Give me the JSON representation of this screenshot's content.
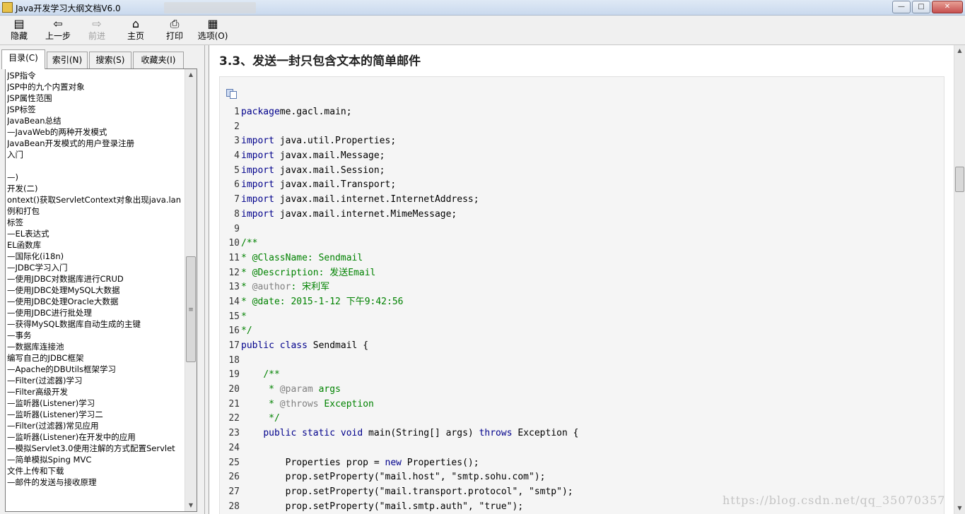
{
  "window": {
    "title": "Java开发学习大纲文档V6.0",
    "minimize": "—",
    "maximize": "□",
    "close": "✕"
  },
  "toolbar": {
    "buttons": [
      {
        "label": "隐藏",
        "icon": "hide-icon",
        "glyph": "▤",
        "enabled": true
      },
      {
        "label": "上一步",
        "icon": "back-arrow-icon",
        "glyph": "⇦",
        "enabled": true
      },
      {
        "label": "前进",
        "icon": "forward-arrow-icon",
        "glyph": "⇨",
        "enabled": false
      },
      {
        "label": "主页",
        "icon": "home-icon",
        "glyph": "⌂",
        "enabled": true
      },
      {
        "label": "打印",
        "icon": "printer-icon",
        "glyph": "⎙",
        "enabled": true
      },
      {
        "label": "选项(O)",
        "icon": "options-icon",
        "glyph": "▦",
        "enabled": true
      }
    ]
  },
  "navigation": {
    "tabs": [
      "目录(C)",
      "索引(N)",
      "搜索(S)",
      "收藏夹(I)"
    ],
    "active_tab": "目录(C)",
    "tree_items": [
      "JSP指令",
      "JSP中的九个内置对象",
      "JSP属性范围",
      "JSP标签",
      "JavaBean总结",
      "—JavaWeb的两种开发模式",
      "JavaBean开发模式的用户登录注册",
      "入门",
      "",
      "—)",
      "开发(二)",
      "ontext()获取ServletContext对象出现java.lan",
      "例和打包",
      "标签",
      "—EL表达式",
      "EL函数库",
      "—国际化(i18n)",
      "—JDBC学习入门",
      "—使用JDBC对数据库进行CRUD",
      "—使用JDBC处理MySQL大数据",
      "—使用JDBC处理Oracle大数据",
      "—使用JDBC进行批处理",
      "—获得MySQL数据库自动生成的主键",
      "—事务",
      "—数据库连接池",
      "编写自己的JDBC框架",
      "—Apache的DBUtils框架学习",
      "—Filter(过滤器)学习",
      "—Filter高级开发",
      "—监听器(Listener)学习",
      "—监听器(Listener)学习二",
      "—Filter(过滤器)常见应用",
      "—监听器(Listener)在开发中的应用",
      "—模拟Servlet3.0使用注解的方式配置Servlet",
      "—简单模拟Sping MVC",
      "文件上传和下载",
      "—邮件的发送与接收原理"
    ]
  },
  "content": {
    "section_title": "3.3、发送一封只包含文本的简单邮件",
    "code_lines": [
      {
        "n": "1",
        "parts": [
          [
            "kw",
            "package"
          ],
          [
            "",
            "me.gacl.main;"
          ]
        ]
      },
      {
        "n": "2",
        "parts": []
      },
      {
        "n": "3",
        "parts": [
          [
            "kw",
            "import"
          ],
          [
            "",
            " java.util.Properties;"
          ]
        ]
      },
      {
        "n": "4",
        "parts": [
          [
            "kw",
            "import"
          ],
          [
            "",
            " javax.mail.Message;"
          ]
        ]
      },
      {
        "n": "5",
        "parts": [
          [
            "kw",
            "import"
          ],
          [
            "",
            " javax.mail.Session;"
          ]
        ]
      },
      {
        "n": "6",
        "parts": [
          [
            "kw",
            "import"
          ],
          [
            "",
            " javax.mail.Transport;"
          ]
        ]
      },
      {
        "n": "7",
        "parts": [
          [
            "kw",
            "import"
          ],
          [
            "",
            " javax.mail.internet.InternetAddress;"
          ]
        ]
      },
      {
        "n": "8",
        "parts": [
          [
            "kw",
            "import"
          ],
          [
            "",
            " javax.mail.internet.MimeMessage;"
          ]
        ]
      },
      {
        "n": "9",
        "parts": []
      },
      {
        "n": "10",
        "parts": [
          [
            "cm",
            "/**"
          ]
        ]
      },
      {
        "n": "11",
        "parts": [
          [
            "cm",
            "* @ClassName: Sendmail"
          ]
        ]
      },
      {
        "n": "12",
        "parts": [
          [
            "cm",
            "* @Description: 发送Email"
          ]
        ]
      },
      {
        "n": "13",
        "parts": [
          [
            "cm",
            "* "
          ],
          [
            "tg",
            "@author"
          ],
          [
            "cm",
            ": 宋利军"
          ]
        ]
      },
      {
        "n": "14",
        "parts": [
          [
            "cm",
            "* @date: 2015-1-12 下午9:42:56"
          ]
        ]
      },
      {
        "n": "15",
        "parts": [
          [
            "cm",
            "*"
          ]
        ]
      },
      {
        "n": "16",
        "parts": [
          [
            "cm",
            "*/"
          ]
        ]
      },
      {
        "n": "17",
        "parts": [
          [
            "kw",
            "public class"
          ],
          [
            "",
            " Sendmail {"
          ]
        ]
      },
      {
        "n": "18",
        "parts": []
      },
      {
        "n": "19",
        "parts": [
          [
            "",
            "    "
          ],
          [
            "cm",
            "/**"
          ]
        ]
      },
      {
        "n": "20",
        "parts": [
          [
            "",
            "     "
          ],
          [
            "cm",
            "* "
          ],
          [
            "tg",
            "@param"
          ],
          [
            "cm",
            " args"
          ]
        ]
      },
      {
        "n": "21",
        "parts": [
          [
            "",
            "     "
          ],
          [
            "cm",
            "* "
          ],
          [
            "tg",
            "@throws"
          ],
          [
            "cm",
            " Exception"
          ]
        ]
      },
      {
        "n": "22",
        "parts": [
          [
            "",
            "     "
          ],
          [
            "cm",
            "*/"
          ]
        ]
      },
      {
        "n": "23",
        "parts": [
          [
            "",
            "    "
          ],
          [
            "kw",
            "public static void"
          ],
          [
            "",
            " main(String[] args) "
          ],
          [
            "kw",
            "throws"
          ],
          [
            "",
            " Exception {"
          ]
        ]
      },
      {
        "n": "24",
        "parts": []
      },
      {
        "n": "25",
        "parts": [
          [
            "",
            "        Properties prop = "
          ],
          [
            "kw",
            "new"
          ],
          [
            "",
            " Properties();"
          ]
        ]
      },
      {
        "n": "26",
        "parts": [
          [
            "",
            "        prop.setProperty(\"mail.host\", \"smtp.sohu.com\");"
          ]
        ]
      },
      {
        "n": "27",
        "parts": [
          [
            "",
            "        prop.setProperty(\"mail.transport.protocol\", \"smtp\");"
          ]
        ]
      },
      {
        "n": "28",
        "parts": [
          [
            "",
            "        prop.setProperty(\"mail.smtp.auth\", \"true\");"
          ]
        ]
      }
    ]
  },
  "watermark": "https://blog.csdn.net/qq_35070357"
}
